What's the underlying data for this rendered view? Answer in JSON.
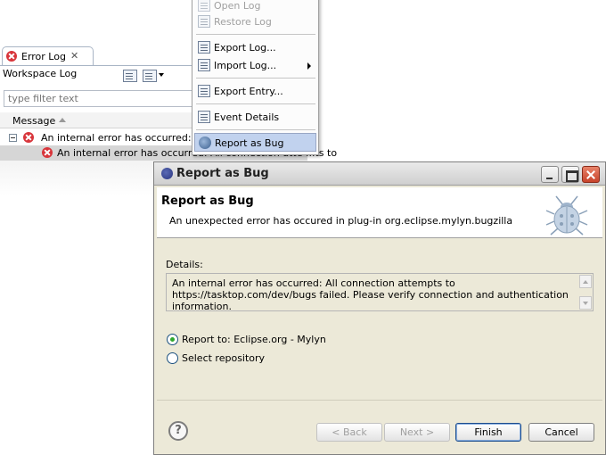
{
  "error_log": {
    "tab_label": "Error Log",
    "tab_close": "✕",
    "workspace_label": "Workspace Log",
    "filter_placeholder": "type filter text",
    "column_header": "Message",
    "rows": [
      {
        "text": "An internal error has occurred: All c"
      },
      {
        "text": "An internal error has occurred: All connection atte ...ts to"
      }
    ]
  },
  "context_menu": {
    "items": [
      {
        "label": "Open Log",
        "enabled": false,
        "icon": "open-log-icon"
      },
      {
        "label": "Restore Log",
        "enabled": false,
        "icon": "restore-log-icon"
      },
      {
        "label": "Export Log...",
        "enabled": true,
        "icon": "export-log-icon"
      },
      {
        "label": "Import Log...",
        "enabled": true,
        "icon": "import-log-icon",
        "submenu": true
      },
      {
        "label": "Export Entry...",
        "enabled": true,
        "icon": "export-entry-icon"
      },
      {
        "label": "Event Details",
        "enabled": true,
        "icon": "event-details-icon"
      },
      {
        "label": "Report as Bug",
        "enabled": true,
        "icon": "report-bug-icon",
        "highlighted": true
      }
    ]
  },
  "dialog": {
    "window_title": "Report as Bug",
    "banner_title": "Report as Bug",
    "banner_message": "An unexpected error has occured in plug-in org.eclipse.mylyn.bugzilla",
    "details_label": "Details:",
    "details_text": "An internal error has occurred: All connection attempts to https://tasktop.com/dev/bugs failed. Please verify connection and authentication information.",
    "options": [
      {
        "label": "Report to: Eclipse.org - Mylyn",
        "checked": true
      },
      {
        "label": "Select repository",
        "checked": false
      }
    ],
    "help_symbol": "?",
    "buttons": {
      "back": "< Back",
      "next": "Next >",
      "finish": "Finish",
      "cancel": "Cancel"
    }
  },
  "colors": {
    "menu_highlight": "#c1d2ee",
    "dialog_bg": "#ece9d8",
    "error_red": "#d8353b",
    "radio_green": "#2fa830"
  }
}
